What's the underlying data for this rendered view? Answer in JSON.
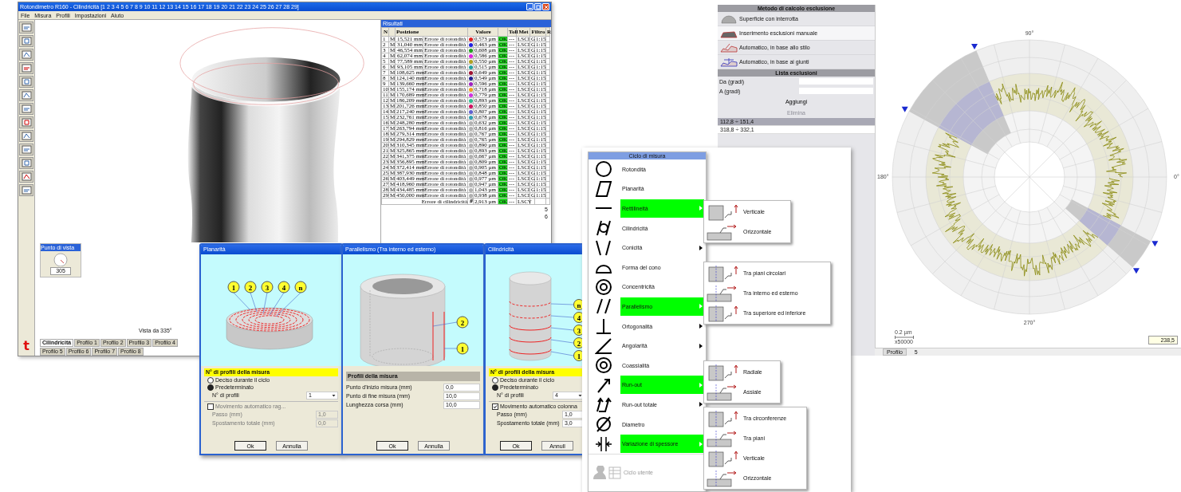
{
  "main_window": {
    "title": "Rotondimetro R160 - Cilindricità [1 2 3 4 5 6 7 8 9 10 11 12 13 14 15 16 17 18 19 20 21 22 23 24 25 26 27 28 29]",
    "menu": [
      "File",
      "Misura",
      "Profili",
      "Impostazioni",
      "Aiuto"
    ],
    "view_widget": {
      "title": "Punto di vista",
      "value": "305"
    },
    "view_caption": "Vista da 335°",
    "logo_text": "t",
    "tabs": [
      {
        "label": "Cilindricità",
        "selected": true
      },
      {
        "label": "Profilo 1",
        "selected": false
      },
      {
        "label": "Profilo 2",
        "selected": false
      },
      {
        "label": "Profilo 3",
        "selected": false
      },
      {
        "label": "Profilo 4",
        "selected": false
      },
      {
        "label": "Profilo 5",
        "selected": false
      },
      {
        "label": "Profilo 6",
        "selected": false
      },
      {
        "label": "Profilo 7",
        "selected": false
      },
      {
        "label": "Profilo 8",
        "selected": false
      }
    ],
    "results": {
      "title": "Risultati",
      "columns": [
        "N",
        "Posizione",
        "Valore",
        "Toll",
        "Met",
        "Filtro",
        "R"
      ],
      "rows": [
        {
          "n": "1",
          "m": "M",
          "pos": "15,521 mm",
          "desc": "Errore di rotondità",
          "color": "#e02020",
          "val": "0,573 µm",
          "ok": "OK",
          "tol": "---",
          "met": "LSCI",
          "f": "G",
          "ratio": "1:15"
        },
        {
          "n": "2",
          "m": "M",
          "pos": "31,040 mm",
          "desc": "Errore di rotondità",
          "color": "#2020e0",
          "val": "0,463 µm",
          "ok": "OK",
          "tol": "---",
          "met": "LSCI",
          "f": "G",
          "ratio": "1:15"
        },
        {
          "n": "3",
          "m": "M",
          "pos": "46,554 mm",
          "desc": "Errore di rotondità",
          "color": "#20a020",
          "val": "0,608 µm",
          "ok": "OK",
          "tol": "---",
          "met": "LSCI",
          "f": "G",
          "ratio": "1:15"
        },
        {
          "n": "4",
          "m": "M",
          "pos": "62,074 mm",
          "desc": "Errore di rotondità",
          "color": "#e020e0",
          "val": "0,586 µm",
          "ok": "OK",
          "tol": "---",
          "met": "LSCI",
          "f": "G",
          "ratio": "1:15"
        },
        {
          "n": "5",
          "m": "M",
          "pos": "77,589 mm",
          "desc": "Errore di rotondità",
          "color": "#b0a020",
          "val": "0,550 µm",
          "ok": "OK",
          "tol": "---",
          "met": "LSCI",
          "f": "G",
          "ratio": "1:15"
        },
        {
          "n": "6",
          "m": "M",
          "pos": "93,105 mm",
          "desc": "Errore di rotondità",
          "color": "#20a0a0",
          "val": "0,515 µm",
          "ok": "OK",
          "tol": "---",
          "met": "LSCI",
          "f": "G",
          "ratio": "1:15"
        },
        {
          "n": "7",
          "m": "M",
          "pos": "108,625 mm",
          "desc": "Errore di rotondità",
          "color": "#a01030",
          "val": "0,649 µm",
          "ok": "OK",
          "tol": "---",
          "met": "LSCI",
          "f": "G",
          "ratio": "1:15"
        },
        {
          "n": "8",
          "m": "M",
          "pos": "124,140 mm",
          "desc": "Errore di rotondità",
          "color": "#202090",
          "val": "0,549 µm",
          "ok": "OK",
          "tol": "---",
          "met": "LSCI",
          "f": "G",
          "ratio": "1:15"
        },
        {
          "n": "9",
          "m": "M",
          "pos": "139,660 mm",
          "desc": "Errore di rotondità",
          "color": "#a020c0",
          "val": "0,596 µm",
          "ok": "OK",
          "tol": "---",
          "met": "LSCI",
          "f": "G",
          "ratio": "1:15"
        },
        {
          "n": "10",
          "m": "M",
          "pos": "155,174 mm",
          "desc": "Errore di rotondità",
          "color": "#f0a020",
          "val": "0,718 µm",
          "ok": "OK",
          "tol": "---",
          "met": "LSCI",
          "f": "G",
          "ratio": "1:15"
        },
        {
          "n": "11",
          "m": "M",
          "pos": "170,689 mm",
          "desc": "Errore di rotondità",
          "color": "#d030e0",
          "val": "0,779 µm",
          "ok": "OK",
          "tol": "---",
          "met": "LSCI",
          "f": "G",
          "ratio": "1:15"
        },
        {
          "n": "12",
          "m": "M",
          "pos": "186,209 mm",
          "desc": "Errore di rotondità",
          "color": "#30c090",
          "val": "0,893 µm",
          "ok": "OK",
          "tol": "---",
          "met": "LSCI",
          "f": "G",
          "ratio": "1:15"
        },
        {
          "n": "13",
          "m": "M",
          "pos": "201,726 mm",
          "desc": "Errore di rotondità",
          "color": "#d01060",
          "val": "0,850 µm",
          "ok": "OK",
          "tol": "---",
          "met": "LSCI",
          "f": "G",
          "ratio": "1:15"
        },
        {
          "n": "14",
          "m": "M",
          "pos": "217,240 mm",
          "desc": "Errore di rotondità",
          "color": "#6060d0",
          "val": "0,807 µm",
          "ok": "OK",
          "tol": "---",
          "met": "LSCI",
          "f": "G",
          "ratio": "1:15"
        },
        {
          "n": "15",
          "m": "M",
          "pos": "232,761 mm",
          "desc": "Errore di rotondità",
          "color": "#30a0b0",
          "val": "0,678 µm",
          "ok": "OK",
          "tol": "---",
          "met": "LSCI",
          "f": "G",
          "ratio": "1:15"
        },
        {
          "n": "16",
          "m": "M",
          "pos": "248,280 mm",
          "desc": "Errore di rotondità",
          "color": "#b0b0b0",
          "val": "0,632 µm",
          "ok": "OK",
          "tol": "---",
          "met": "LSCI",
          "f": "G",
          "ratio": "1:15"
        },
        {
          "n": "17",
          "m": "M",
          "pos": "263,794 mm",
          "desc": "Errore di rotondità",
          "color": "#b0b0b0",
          "val": "0,816 µm",
          "ok": "OK",
          "tol": "---",
          "met": "LSCI",
          "f": "G",
          "ratio": "1:15"
        },
        {
          "n": "18",
          "m": "M",
          "pos": "279,314 mm",
          "desc": "Errore di rotondità",
          "color": "#b0b0b0",
          "val": "0,767 µm",
          "ok": "OK",
          "tol": "---",
          "met": "LSCI",
          "f": "G",
          "ratio": "1:15"
        },
        {
          "n": "19",
          "m": "M",
          "pos": "294,829 mm",
          "desc": "Errore di rotondità",
          "color": "#b0b0b0",
          "val": "0,765 µm",
          "ok": "OK",
          "tol": "---",
          "met": "LSCI",
          "f": "G",
          "ratio": "1:15"
        },
        {
          "n": "20",
          "m": "M",
          "pos": "310,345 mm",
          "desc": "Errore di rotondità",
          "color": "#b0b0b0",
          "val": "0,890 µm",
          "ok": "OK",
          "tol": "---",
          "met": "LSCI",
          "f": "G",
          "ratio": "1:15"
        },
        {
          "n": "21",
          "m": "M",
          "pos": "325,865 mm",
          "desc": "Errore di rotondità",
          "color": "#b0b0b0",
          "val": "0,893 µm",
          "ok": "OK",
          "tol": "---",
          "met": "LSCI",
          "f": "G",
          "ratio": "1:15"
        },
        {
          "n": "22",
          "m": "M",
          "pos": "341,375 mm",
          "desc": "Errore di rotondità",
          "color": "#b0b0b0",
          "val": "0,667 µm",
          "ok": "OK",
          "tol": "---",
          "met": "LSCI",
          "f": "G",
          "ratio": "1:15"
        },
        {
          "n": "23",
          "m": "M",
          "pos": "356,895 mm",
          "desc": "Errore di rotondità",
          "color": "#b0b0b0",
          "val": "0,809 µm",
          "ok": "OK",
          "tol": "---",
          "met": "LSCI",
          "f": "G",
          "ratio": "1:15"
        },
        {
          "n": "24",
          "m": "M",
          "pos": "372,414 mm",
          "desc": "Errore di rotondità",
          "color": "#b0b0b0",
          "val": "0,905 µm",
          "ok": "OK",
          "tol": "---",
          "met": "LSCI",
          "f": "G",
          "ratio": "1:15"
        },
        {
          "n": "25",
          "m": "M",
          "pos": "387,930 mm",
          "desc": "Errore di rotondità",
          "color": "#b0b0b0",
          "val": "0,848 µm",
          "ok": "OK",
          "tol": "---",
          "met": "LSCI",
          "f": "G",
          "ratio": "1:15"
        },
        {
          "n": "26",
          "m": "M",
          "pos": "403,449 mm",
          "desc": "Errore di rotondità",
          "color": "#b0b0b0",
          "val": "0,977 µm",
          "ok": "OK",
          "tol": "---",
          "met": "LSCI",
          "f": "G",
          "ratio": "1:15"
        },
        {
          "n": "27",
          "m": "M",
          "pos": "418,960 mm",
          "desc": "Errore di rotondità",
          "color": "#b0b0b0",
          "val": "0,947 µm",
          "ok": "OK",
          "tol": "---",
          "met": "LSCI",
          "f": "G",
          "ratio": "1:15"
        },
        {
          "n": "28",
          "m": "M",
          "pos": "434,485 mm",
          "desc": "Errore di rotondità",
          "color": "#b0b0b0",
          "val": "1,043 µm",
          "ok": "OK",
          "tol": "---",
          "met": "LSCI",
          "f": "G",
          "ratio": "1:15"
        },
        {
          "n": "29",
          "m": "M",
          "pos": "450,000 mm",
          "desc": "Errore di rotondità",
          "color": "#b0b0b0",
          "val": "0,938 µm",
          "ok": "OK",
          "tol": "---",
          "met": "LSCI",
          "f": "G",
          "ratio": "1:15"
        }
      ],
      "total": {
        "desc": "Errore di cilindricità",
        "val": "2,913 µm",
        "ok": "OK",
        "tol": "---",
        "met": "LSCY"
      },
      "side_numbers": [
        "5",
        "6"
      ]
    }
  },
  "dialogs": [
    {
      "title": "Planarità",
      "kind": "disk",
      "callouts": [
        "1",
        "2",
        "3",
        "4",
        "n"
      ],
      "form": {
        "kind": "profiles",
        "section": "N° di profili della misura",
        "radios": [
          {
            "label": "Deciso durante il ciclo",
            "selected": false
          },
          {
            "label": "Predeterminato",
            "selected": true
          }
        ],
        "count_label": "N° di profili",
        "count_value": "1",
        "auto_move": {
          "label": "Movimento automatico rag...",
          "checked": false
        },
        "fields": [
          {
            "label": "Passo (mm)",
            "value": "1,0"
          },
          {
            "label": "Spostamento totale (mm)",
            "value": "0,0"
          }
        ],
        "disabled": true,
        "buttons": [
          "Ok",
          "Annulla"
        ]
      }
    },
    {
      "title": "Parallelismo (Tra interno ed esterno)",
      "kind": "tube",
      "callouts": [
        "2",
        "1"
      ],
      "form": {
        "kind": "range",
        "section": "Profili della misura",
        "fields": [
          {
            "label": "Punto d'inizio misura (mm)",
            "value": "0,0"
          },
          {
            "label": "Punto di fine misura (mm)",
            "value": "10,0"
          },
          {
            "label": "Lunghezza corsa (mm)",
            "value": "10,0"
          }
        ],
        "buttons": [
          "Ok",
          "Annulla"
        ]
      }
    },
    {
      "title": "Cilindricità",
      "kind": "cylinder",
      "callouts": [
        "n",
        "4",
        "3",
        "2",
        "1"
      ],
      "form": {
        "kind": "profiles",
        "section": "N° di profili della misura",
        "radios": [
          {
            "label": "Deciso durante il ciclo",
            "selected": false
          },
          {
            "label": "Predeterminato",
            "selected": true
          }
        ],
        "count_label": "N° di profili",
        "count_value": "4",
        "auto_move": {
          "label": "Movimento automatico colonna",
          "checked": true
        },
        "fields": [
          {
            "label": "Passo (mm)",
            "value": "1,0"
          },
          {
            "label": "Spostamento totale (mm)",
            "value": "3,0"
          }
        ],
        "disabled": false,
        "buttons": [
          "Ok",
          "Annull"
        ]
      }
    }
  ],
  "cycle_menu": {
    "title": "Ciclo di misura",
    "items": [
      {
        "label": "Rotondità",
        "selected": false,
        "submenu": false
      },
      {
        "label": "Planarità",
        "selected": false,
        "submenu": false
      },
      {
        "label": "Rettilineità",
        "selected": true,
        "submenu": true
      },
      {
        "label": "Cilindricità",
        "selected": false,
        "submenu": false
      },
      {
        "label": "Conicità",
        "selected": false,
        "submenu": true
      },
      {
        "label": "Forma del cono",
        "selected": false,
        "submenu": false
      },
      {
        "label": "Concentricità",
        "selected": false,
        "submenu": false
      },
      {
        "label": "Parallelismo",
        "selected": true,
        "submenu": true
      },
      {
        "label": "Ortogonalità",
        "selected": false,
        "submenu": true
      },
      {
        "label": "Angolarità",
        "selected": false,
        "submenu": true
      },
      {
        "label": "Coassialità",
        "selected": false,
        "submenu": false
      },
      {
        "label": "Run-out",
        "selected": true,
        "submenu": true
      },
      {
        "label": "Run-out totale",
        "selected": false,
        "submenu": true
      },
      {
        "label": "Diametro",
        "selected": false,
        "submenu": false
      },
      {
        "label": "Variazione di spessore",
        "selected": true,
        "submenu": true
      }
    ],
    "footer": {
      "label": "Ciclo utente",
      "disabled": true
    },
    "submenus": [
      {
        "items": [
          "Verticale",
          "Orizzontale"
        ]
      },
      {
        "items": [
          "Tra piani circolari",
          "Tra interno ed esterno",
          "Tra superiore ed inferiore"
        ]
      },
      {
        "items": [
          "Radiale",
          "Assiale"
        ]
      },
      {
        "items": [
          "Tra circonferenze",
          "Tra piani",
          "Verticale",
          "Orizzontale"
        ]
      }
    ]
  },
  "exclusion_window": {
    "method_title": "Metodo di calcolo esclusione",
    "methods": [
      {
        "label": "Superficie con interrotta",
        "selected": false
      },
      {
        "label": "Inserimento esclusioni manuale",
        "selected": true
      },
      {
        "label": "Automatico, in base allo stilo",
        "selected": false
      },
      {
        "label": "Automatico, in base ai giunti",
        "selected": false
      }
    ],
    "list_title": "Lista esclusioni",
    "fields": [
      {
        "label": "Da (gradi)"
      },
      {
        "label": "A (gradi)"
      }
    ],
    "add_button": "Aggiungi",
    "delete_button": {
      "label": "Elimina",
      "disabled": true
    },
    "exclusions": [
      {
        "label": "112,8 ÷ 151,4",
        "selected": true
      },
      {
        "label": "318,8 ÷ 332,1",
        "selected": false
      }
    ],
    "polar": {
      "top": "90°",
      "left": "180°",
      "right": "0°",
      "bottom": "270°",
      "scale": "0.2 µm",
      "magnification": "x50000",
      "value": "238,5"
    },
    "bottom_tab": "Profilo",
    "bottom_value": "5"
  }
}
